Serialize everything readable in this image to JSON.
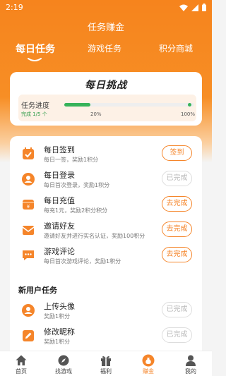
{
  "status_bar": {
    "time": "2:19"
  },
  "header": {
    "title": "任务赚金"
  },
  "tabs": [
    {
      "label": "每日任务",
      "active": true
    },
    {
      "label": "游戏任务",
      "active": false
    },
    {
      "label": "积分商城",
      "active": false
    }
  ],
  "challenge": {
    "title": "每日挑战",
    "progress_label": "任务进度",
    "completed_text": "完成 1/5 个",
    "progress_fraction": 0.2,
    "ticks": [
      "20%",
      "100%"
    ]
  },
  "daily_tasks": [
    {
      "name": "每日签到",
      "desc": "每日一签，奖励1积分",
      "button": "签到",
      "state": "active",
      "icon": "calendar-check-icon"
    },
    {
      "name": "每日登录",
      "desc": "每日首次登录，奖励1积分",
      "button": "已完成",
      "state": "done",
      "icon": "user-icon"
    },
    {
      "name": "每日充值",
      "desc": "每充1元，奖励2积分积分",
      "button": "去完成",
      "state": "active",
      "icon": "wallet-icon"
    },
    {
      "name": "邀请好友",
      "desc": "邀请好友并进行实名认证，奖励100积分",
      "button": "去完成",
      "state": "active",
      "icon": "mail-icon"
    },
    {
      "name": "游戏评论",
      "desc": "每日首次游戏评论，奖励1积分",
      "button": "去完成",
      "state": "active",
      "icon": "comment-icon"
    }
  ],
  "new_user_section": {
    "title": "新用户任务"
  },
  "new_user_tasks": [
    {
      "name": "上传头像",
      "desc": "奖励1积分",
      "button": "已完成",
      "state": "done",
      "icon": "avatar-icon"
    },
    {
      "name": "修改昵称",
      "desc": "奖励1积分",
      "button": "已完成",
      "state": "done",
      "icon": "edit-icon"
    }
  ],
  "bottom_nav": [
    {
      "label": "首页",
      "icon": "home-icon",
      "active": false
    },
    {
      "label": "找游戏",
      "icon": "compass-icon",
      "active": false
    },
    {
      "label": "福利",
      "icon": "gift-icon",
      "active": false
    },
    {
      "label": "赚金",
      "icon": "money-bag-icon",
      "active": true
    },
    {
      "label": "我的",
      "icon": "profile-icon",
      "active": false
    }
  ],
  "colors": {
    "accent": "#f5852a",
    "progress": "#36b35a",
    "done_text": "#bbbbbb"
  }
}
